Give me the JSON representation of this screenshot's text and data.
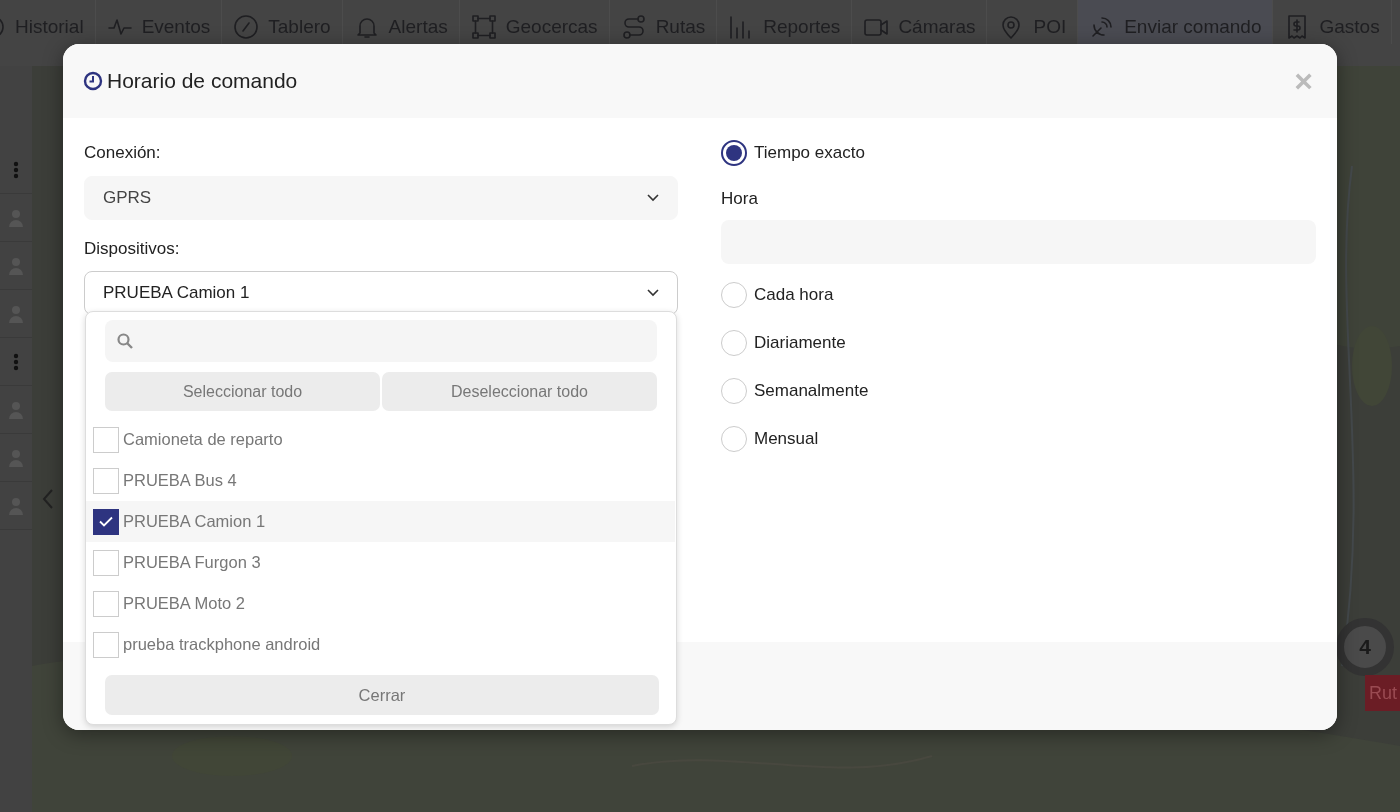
{
  "nav": {
    "items": [
      {
        "label": "Historial",
        "selected": false
      },
      {
        "label": "Eventos",
        "selected": false
      },
      {
        "label": "Tablero",
        "selected": false
      },
      {
        "label": "Alertas",
        "selected": false
      },
      {
        "label": "Geocercas",
        "selected": false
      },
      {
        "label": "Rutas",
        "selected": false
      },
      {
        "label": "Reportes",
        "selected": false
      },
      {
        "label": "Cámaras",
        "selected": false
      },
      {
        "label": "POI",
        "selected": false
      },
      {
        "label": "Enviar comando",
        "selected": true
      },
      {
        "label": "Gastos",
        "selected": false
      }
    ]
  },
  "map": {
    "cluster_count": "4",
    "route_label": "Rut"
  },
  "modal": {
    "title": "Horario de comando",
    "close": "×",
    "connection": {
      "label": "Conexión:",
      "value": "GPRS"
    },
    "devices": {
      "label": "Dispositivos:",
      "value": "PRUEBA Camion 1",
      "expanded": true,
      "select_all": "Seleccionar todo",
      "deselect_all": "Deseleccionar todo",
      "options": [
        {
          "label": "Camioneta de reparto",
          "checked": false
        },
        {
          "label": "PRUEBA Bus 4",
          "checked": false
        },
        {
          "label": "PRUEBA Camion 1",
          "checked": true
        },
        {
          "label": "PRUEBA Furgon 3",
          "checked": false
        },
        {
          "label": "PRUEBA Moto 2",
          "checked": false
        },
        {
          "label": "prueba trackphone android",
          "checked": false
        }
      ],
      "close_button": "Cerrar"
    },
    "schedule": {
      "options": [
        {
          "label": "Tiempo exacto",
          "selected": true,
          "field_label": "Hora"
        },
        {
          "label": "Cada hora",
          "selected": false
        },
        {
          "label": "Diariamente",
          "selected": false
        },
        {
          "label": "Semanalmente",
          "selected": false
        },
        {
          "label": "Mensual",
          "selected": false
        }
      ]
    }
  }
}
